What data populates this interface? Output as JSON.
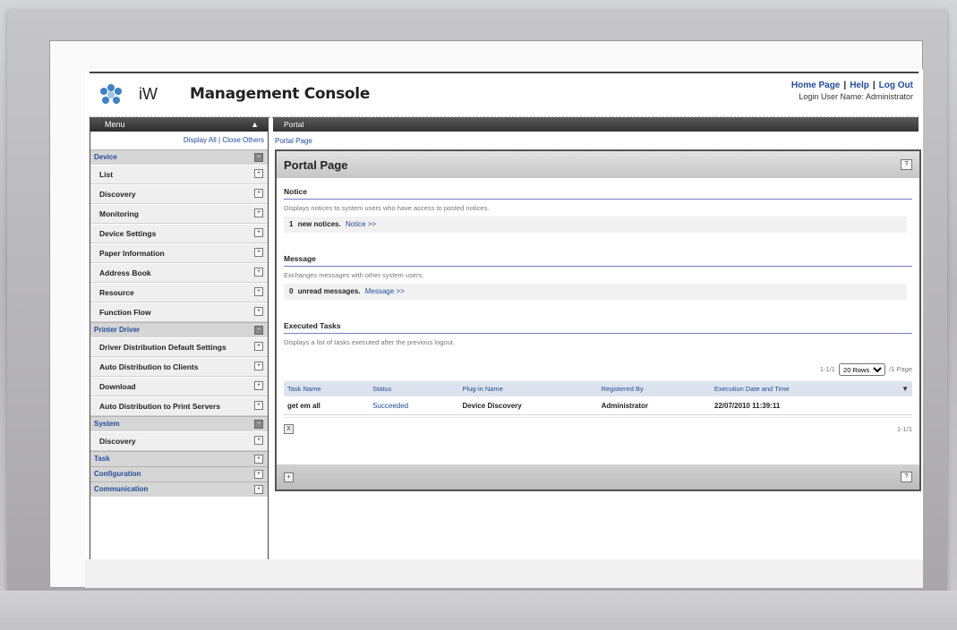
{
  "header": {
    "brand_mark": "iW",
    "title": "Management Console",
    "links": {
      "home": "Home Page",
      "help": "Help",
      "logout": "Log Out",
      "separator": "|"
    },
    "login_label": "Login User Name:",
    "login_user": "Administrator"
  },
  "menu": {
    "title": "Menu",
    "caret": "▲",
    "display_all": "Display All",
    "separator": "|",
    "close_others": "Close Others",
    "sections": [
      {
        "label": "Device",
        "expanded": true,
        "items": [
          "List",
          "Discovery",
          "Monitoring",
          "Device Settings",
          "Paper Information",
          "Address Book",
          "Resource",
          "Function Flow"
        ]
      },
      {
        "label": "Printer Driver",
        "expanded": true,
        "items": [
          "Driver Distribution Default Settings",
          "Auto Distribution to Clients",
          "Download",
          "Auto Distribution to Print Servers"
        ]
      },
      {
        "label": "System",
        "expanded": true,
        "items": [
          "Discovery"
        ]
      },
      {
        "label": "Task",
        "expanded": false,
        "items": []
      },
      {
        "label": "Configuration",
        "expanded": false,
        "items": []
      },
      {
        "label": "Communication",
        "expanded": false,
        "items": []
      }
    ]
  },
  "breadcrumb": {
    "bar": "Portal",
    "path": "Portal Page"
  },
  "portal": {
    "title": "Portal Page",
    "help_icon": "?",
    "notice": {
      "title": "Notice",
      "description": "Displays notices to system users who have access to posted notices.",
      "count": "1",
      "text": "new notices.",
      "link": "Notice >>"
    },
    "message": {
      "title": "Message",
      "description": "Exchanges messages with other system users.",
      "count": "0",
      "text": "unread messages.",
      "link": "Message >>"
    },
    "tasks": {
      "title": "Executed Tasks",
      "description": "Displays a list of tasks executed after the previous logout.",
      "pager_range": "1-1/1",
      "rows_option": "20 Rows",
      "pager_pages": "/1 Page",
      "columns": [
        "Task Name",
        "Status",
        "Plug-in Name",
        "Registered By",
        "Execution Date and Time"
      ],
      "sort_icon": "▼",
      "rows": [
        {
          "task_name": "get em all",
          "status": "Succeeded",
          "plugin": "Device Discovery",
          "registered_by": "Administrator",
          "executed": "22/07/2010 11:39:11"
        }
      ],
      "footer_range": "1-1/1",
      "table_btn": "X"
    },
    "footer_btn": "+",
    "footer_help": "?"
  }
}
